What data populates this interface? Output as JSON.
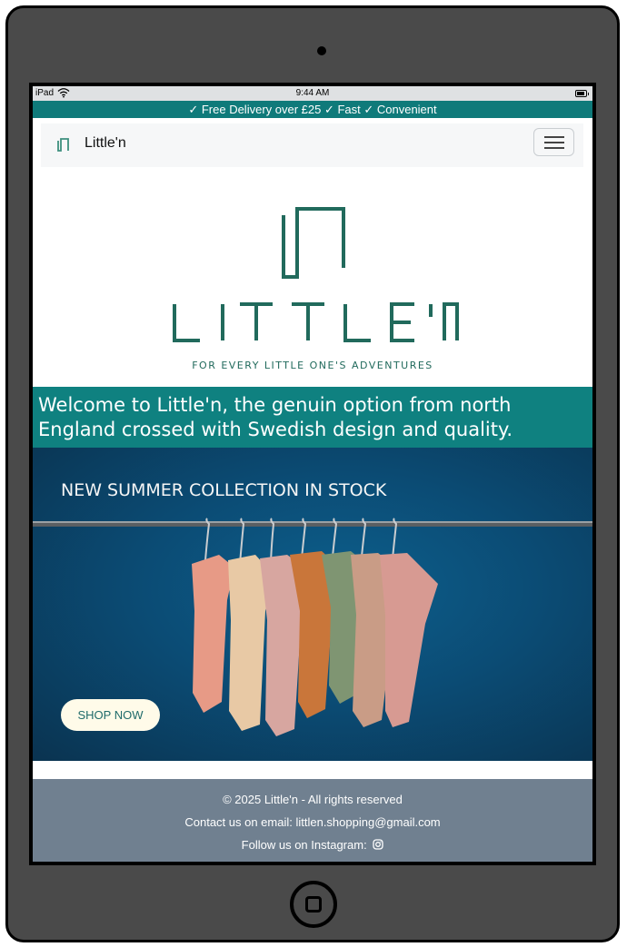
{
  "status_bar": {
    "carrier": "iPad",
    "time": "9:44 AM"
  },
  "promo": {
    "text": "✓ Free Delivery over £25 ✓ Fast ✓ Convenient"
  },
  "navbar": {
    "brand": "Little'n"
  },
  "hero": {
    "logo_text": "LITTLE'N",
    "tagline": "FOR EVERY LITTLE ONE'S ADVENTURES"
  },
  "welcome": {
    "text": "Welcome to Little'n, the genuin option from north England crossed with Swedish design and quality."
  },
  "banner": {
    "title": "NEW SUMMER COLLECTION IN STOCK",
    "button": "SHOP NOW"
  },
  "footer": {
    "copyright": "© 2025 Little'n - All rights reserved",
    "contact": "Contact us on email: littlen.shopping@gmail.com",
    "instagram": "Follow us on Instagram:"
  },
  "colors": {
    "brand_teal": "#0f8180",
    "footer_gray": "#708090",
    "banner_blue": "#0b4c75"
  },
  "icons": [
    "wifi-icon",
    "battery-icon",
    "menu-icon",
    "instagram-icon"
  ]
}
